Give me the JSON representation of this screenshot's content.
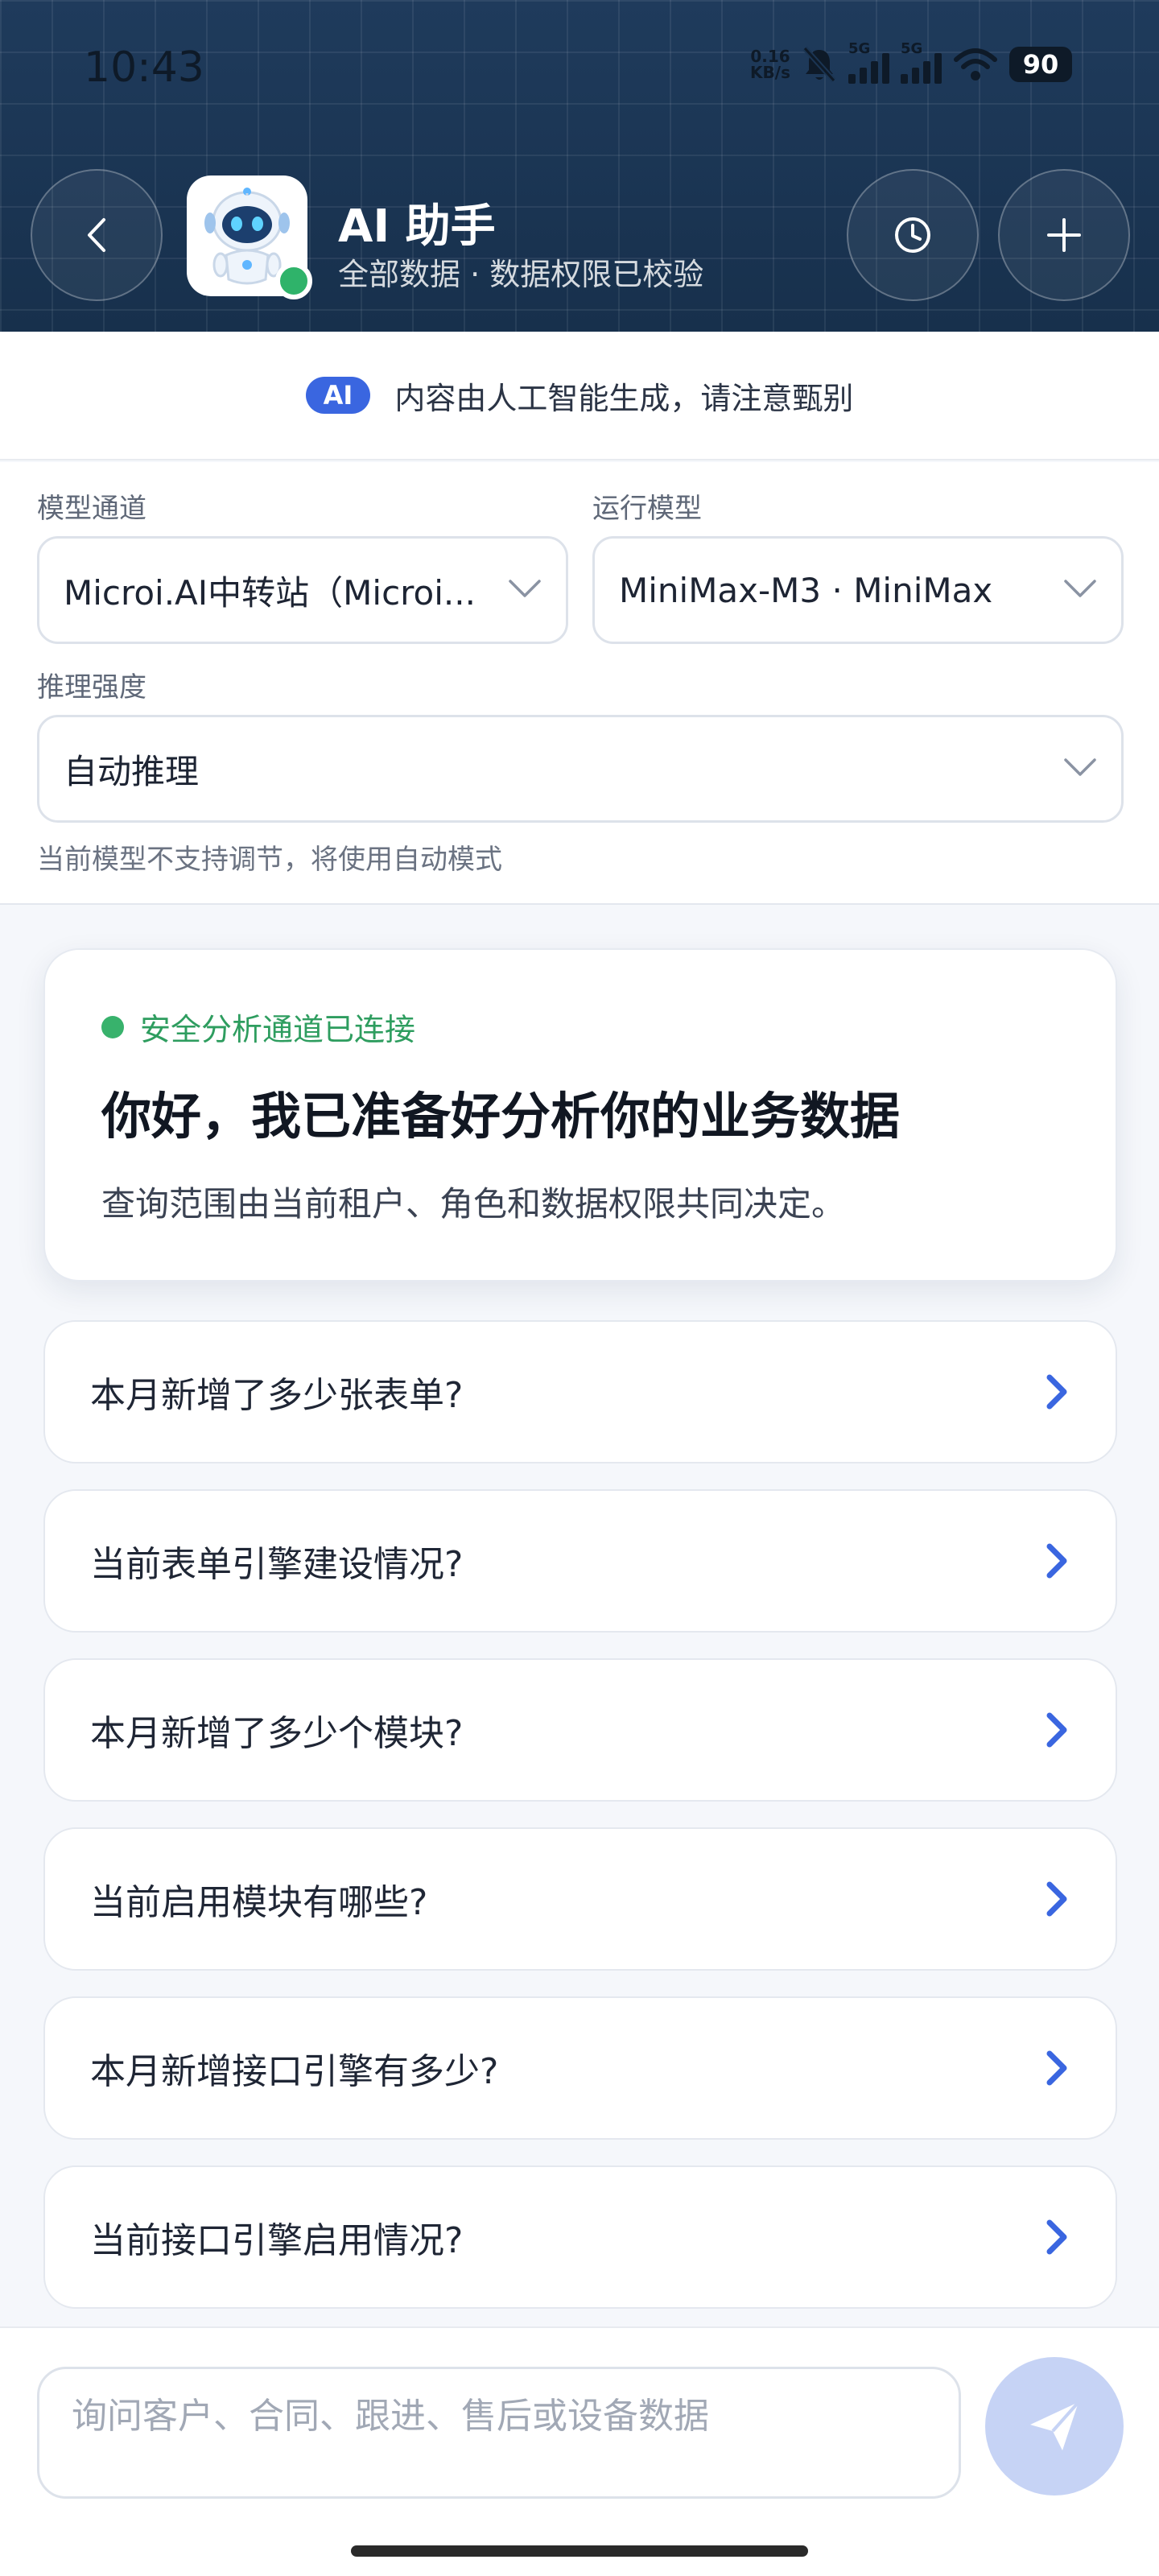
{
  "status_bar": {
    "time": "10:43",
    "net_speed_value": "0.16",
    "net_speed_unit": "KB/s",
    "sim1_label": "5G",
    "sim2_label": "5G",
    "battery": "90"
  },
  "header": {
    "title": "AI 助手",
    "subtitle": "全部数据 · 数据权限已校验",
    "icons": {
      "back": "chevron-left-icon",
      "history": "clock-icon",
      "add": "plus-icon",
      "avatar": "robot-icon"
    }
  },
  "notice": {
    "badge": "AI",
    "text": "内容由人工智能生成，请注意甄别"
  },
  "settings": {
    "channel_label": "模型通道",
    "channel_value": "Microi.AI中转站（Microi...",
    "model_label": "运行模型",
    "model_value": "MiniMax-M3 · MiniMax",
    "reasoning_label": "推理强度",
    "reasoning_value": "自动推理",
    "hint": "当前模型不支持调节，将使用自动模式"
  },
  "welcome": {
    "status": "安全分析通道已连接",
    "title": "你好，我已准备好分析你的业务数据",
    "description": "查询范围由当前租户、角色和数据权限共同决定。"
  },
  "suggestions": [
    "本月新增了多少张表单?",
    "当前表单引擎建设情况?",
    "本月新增了多少个模块?",
    "当前启用模块有哪些?",
    "本月新增接口引擎有多少?",
    "当前接口引擎启用情况?"
  ],
  "composer": {
    "placeholder": "询问客户、合同、跟进、售后或设备数据",
    "value": ""
  },
  "colors": {
    "accent": "#3a66e0",
    "header_bg": "#1b3553",
    "online": "#2fb36a",
    "connected_text": "#2e9d5f",
    "send_button": "#c6d3f5"
  }
}
